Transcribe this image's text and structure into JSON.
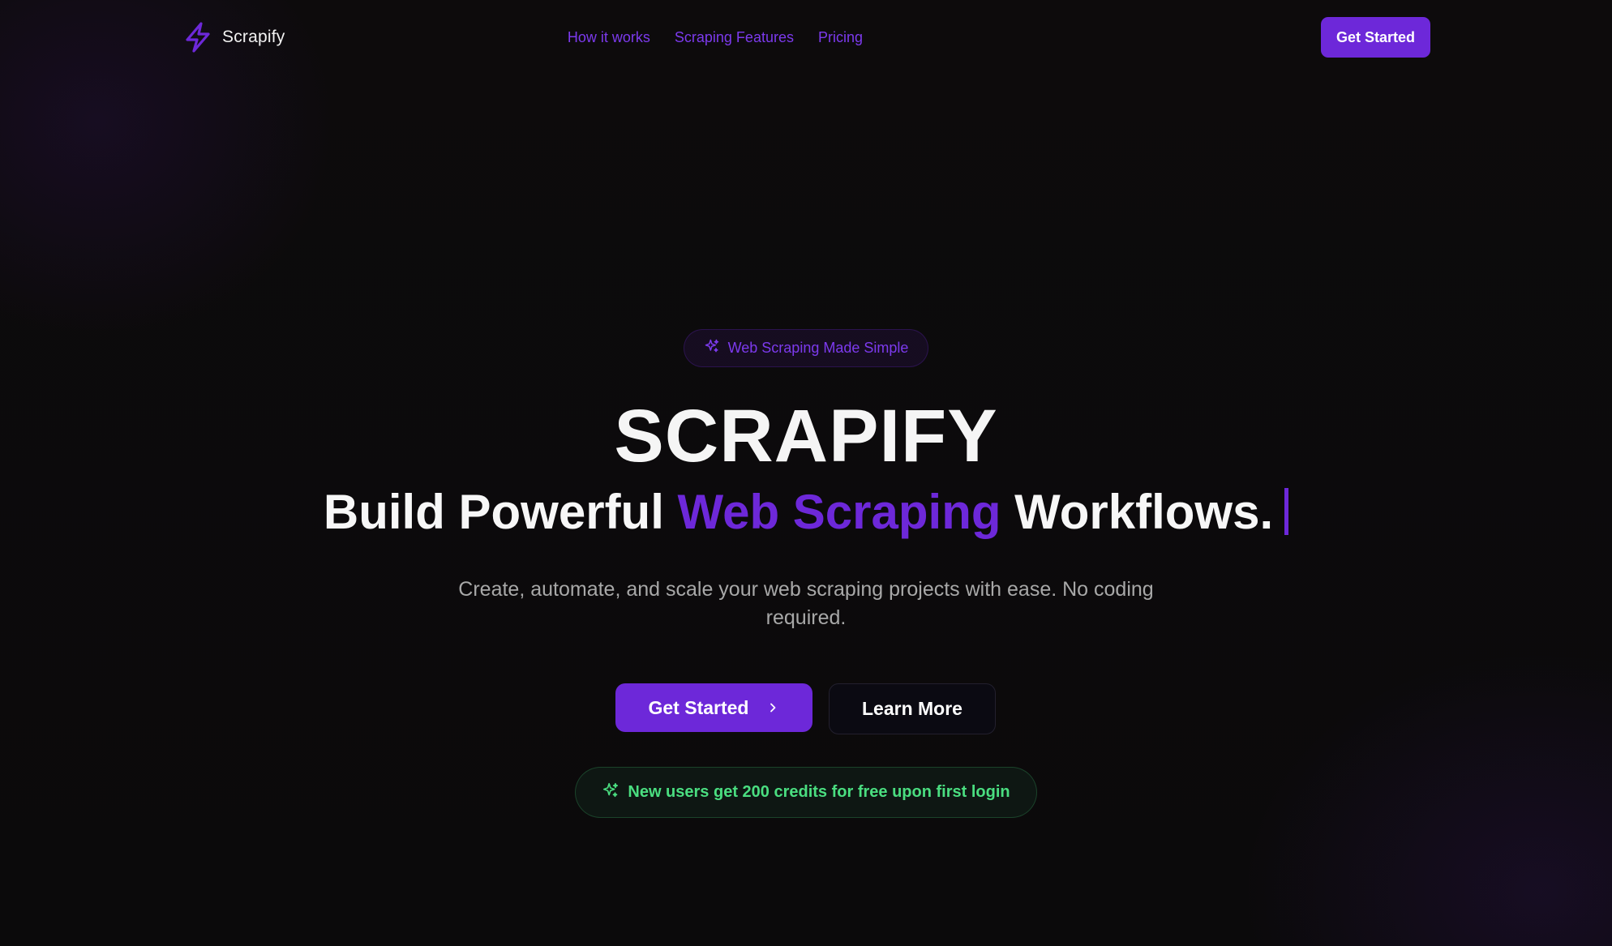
{
  "nav": {
    "brand_name": "Scrapify",
    "brand_icon": "lightning-bolt-icon",
    "links": [
      "How it works",
      "Scraping Features",
      "Pricing"
    ],
    "cta_label": "Get Started"
  },
  "hero": {
    "badge_icon": "sparkles-icon",
    "badge_text": "Web Scraping Made Simple",
    "title": "SCRAPIFY",
    "subtitle_before": "Build Powerful ",
    "subtitle_accent": "Web Scraping",
    "subtitle_after": " Workflows.",
    "description": "Create, automate, and scale your web scraping projects with ease. No coding required.",
    "primary_button": "Get Started",
    "primary_button_icon": "chevron-right-icon",
    "secondary_button": "Learn More",
    "promo_icon": "sparkles-icon",
    "promo_text": "New users get 200 credits for free upon first login"
  },
  "colors": {
    "accent": "#6d28d9",
    "background": "#0c0a0b",
    "promo": "#4ade80"
  }
}
